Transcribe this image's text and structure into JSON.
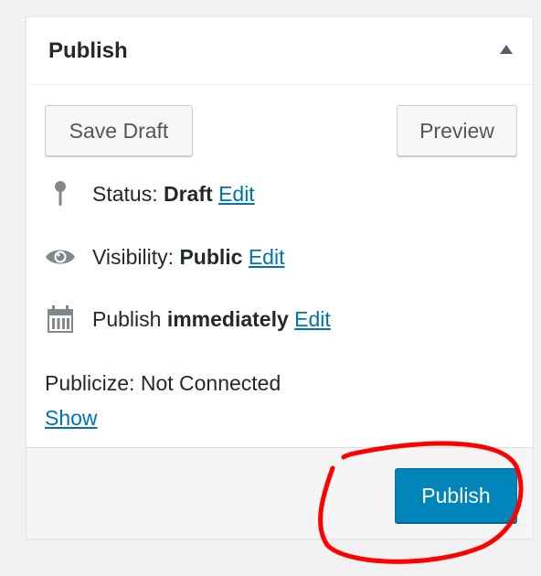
{
  "panel": {
    "title": "Publish",
    "toggle_icon": "triangle-up-icon"
  },
  "buttons": {
    "save_draft": "Save Draft",
    "preview": "Preview",
    "publish": "Publish"
  },
  "status": {
    "icon": "pin-icon",
    "label": "Status:",
    "value": "Draft",
    "edit": "Edit"
  },
  "visibility": {
    "icon": "eye-icon",
    "label": "Visibility:",
    "value": "Public",
    "edit": "Edit"
  },
  "schedule": {
    "icon": "calendar-icon",
    "label": "Publish",
    "value": "immediately",
    "edit": "Edit"
  },
  "publicize": {
    "label": "Publicize:",
    "value": "Not Connected",
    "show": "Show"
  },
  "colors": {
    "link": "#0073aa",
    "primary_button": "#0085ba",
    "annotation": "#ff0000"
  }
}
